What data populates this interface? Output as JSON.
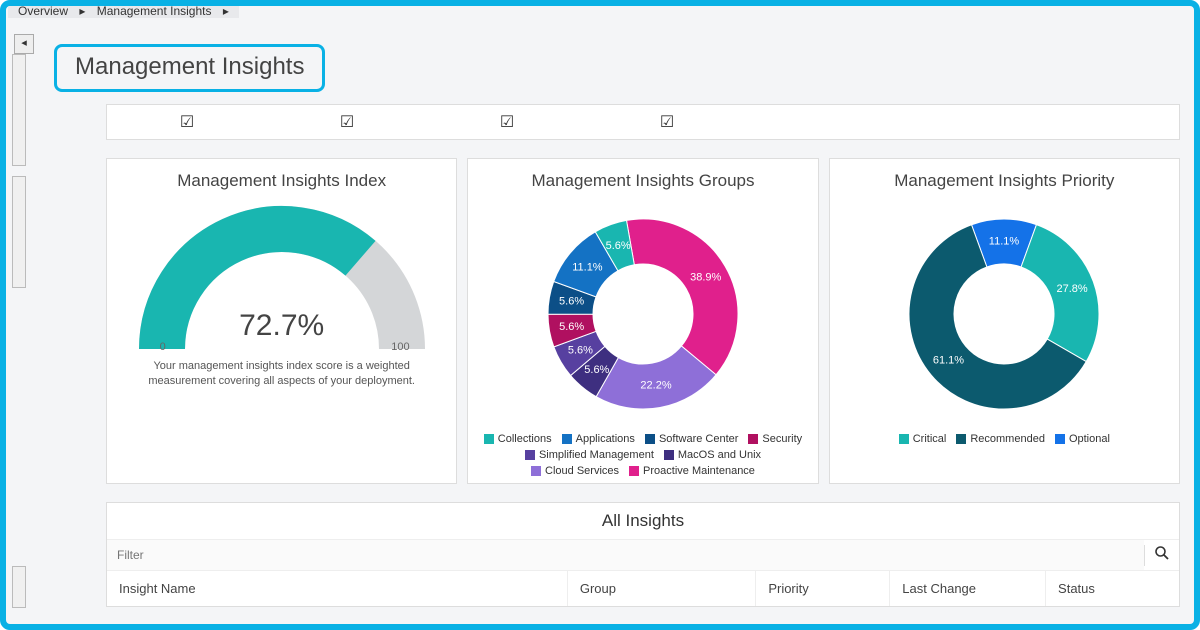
{
  "breadcrumbs": [
    "Overview",
    "Management Insights"
  ],
  "page_title": "Management Insights",
  "cards": {
    "index": {
      "title": "Management Insights Index",
      "value_label": "72.7%",
      "min": "0",
      "max": "100",
      "description": "Your management insights index score is a weighted measurement covering all aspects of your deployment."
    },
    "groups": {
      "title": "Management Insights Groups"
    },
    "priority": {
      "title": "Management Insights Priority"
    }
  },
  "all_insights": {
    "title": "All Insights",
    "filter_placeholder": "Filter",
    "columns": {
      "name": "Insight Name",
      "group": "Group",
      "priority": "Priority",
      "last": "Last Change",
      "status": "Status"
    }
  },
  "chart_data": [
    {
      "type": "pie",
      "name": "groups",
      "title": "Management Insights Groups",
      "donut": true,
      "series": [
        {
          "name": "Collections",
          "value": 5.6,
          "label": "5.6%",
          "color": "#19b6b0"
        },
        {
          "name": "Applications",
          "value": 11.1,
          "label": "11.1%",
          "color": "#1472c4"
        },
        {
          "name": "Software Center",
          "value": 5.6,
          "label": "5.6%",
          "color": "#0c4f87"
        },
        {
          "name": "Security",
          "value": 5.6,
          "label": "5.6%",
          "color": "#b01060"
        },
        {
          "name": "Simplified Management",
          "value": 5.6,
          "label": "5.6%",
          "color": "#5740a0"
        },
        {
          "name": "MacOS and Unix",
          "value": 5.6,
          "label": "5.6%",
          "color": "#3e2f80"
        },
        {
          "name": "Cloud Services",
          "value": 22.2,
          "label": "22.2%",
          "color": "#8e6fd8"
        },
        {
          "name": "Proactive Maintenance",
          "value": 38.9,
          "label": "38.9%",
          "color": "#e0208c"
        }
      ]
    },
    {
      "type": "pie",
      "name": "priority",
      "title": "Management Insights Priority",
      "donut": true,
      "series": [
        {
          "name": "Critical",
          "value": 27.8,
          "label": "27.8%",
          "color": "#19b6b0"
        },
        {
          "name": "Recommended",
          "value": 61.1,
          "label": "61.1%",
          "color": "#0c5a6e"
        },
        {
          "name": "Optional",
          "value": 11.1,
          "label": "11.1%",
          "color": "#1472e8"
        }
      ]
    },
    {
      "type": "area",
      "name": "index_gauge",
      "title": "Management Insights Index",
      "value": 72.7,
      "range": [
        0,
        100
      ],
      "fill_color": "#19b6b0",
      "track_color": "#d4d6d8"
    }
  ]
}
